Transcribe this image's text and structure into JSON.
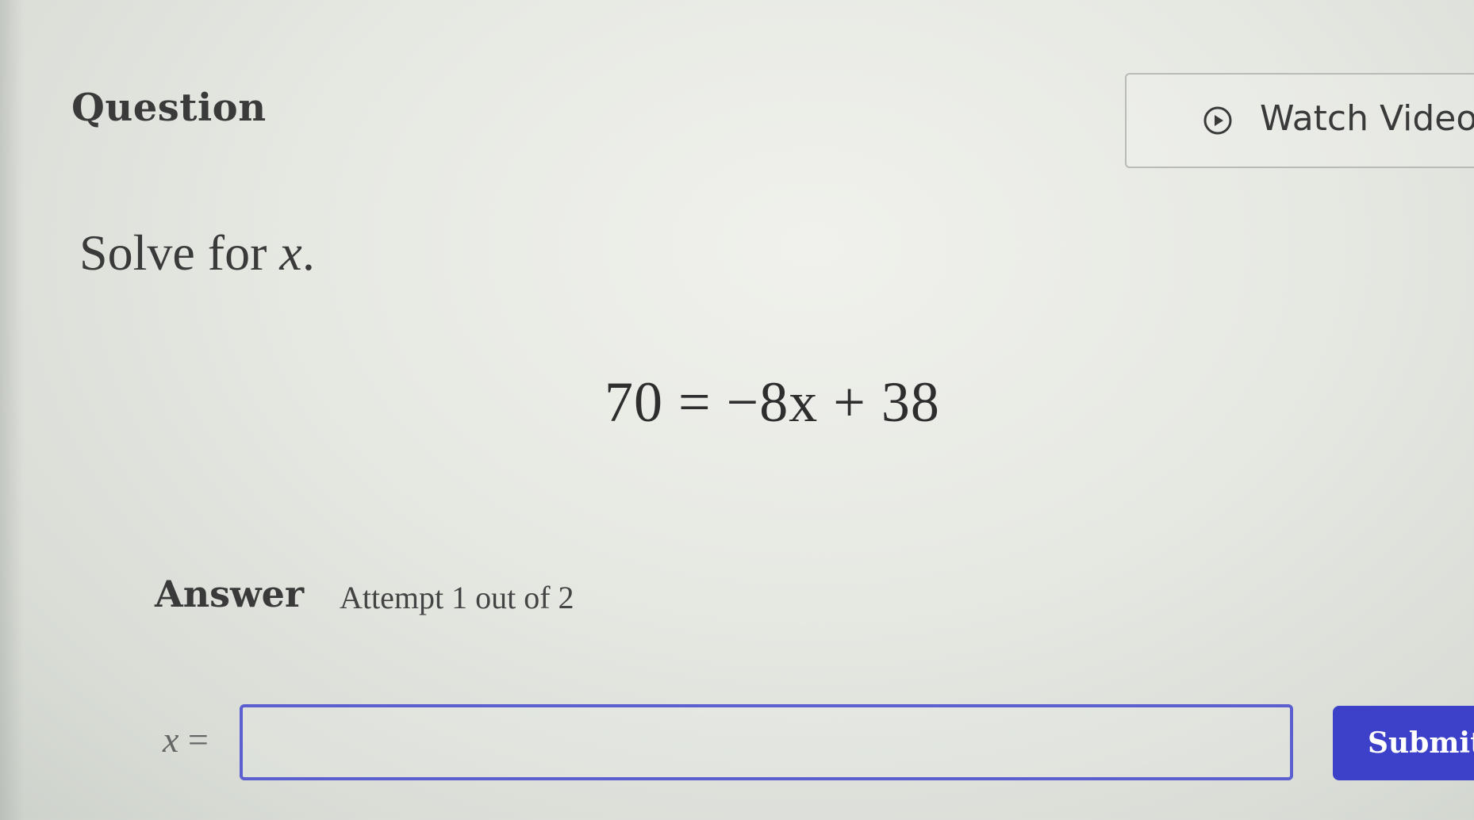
{
  "question": {
    "heading": "Question",
    "prompt_text": "Solve for ",
    "prompt_variable": "x",
    "prompt_end": ".",
    "equation": "70 = −8x + 38"
  },
  "video": {
    "label": "Watch Video",
    "icon": "play-circle-icon"
  },
  "answer": {
    "label": "Answer",
    "attempt_text": "Attempt 1 out of 2",
    "input_variable": "x",
    "input_equals": " =",
    "input_value": "",
    "submit_label": "Submit"
  },
  "colors": {
    "accent": "#3d40c8",
    "input_border": "#5b5fcf"
  }
}
